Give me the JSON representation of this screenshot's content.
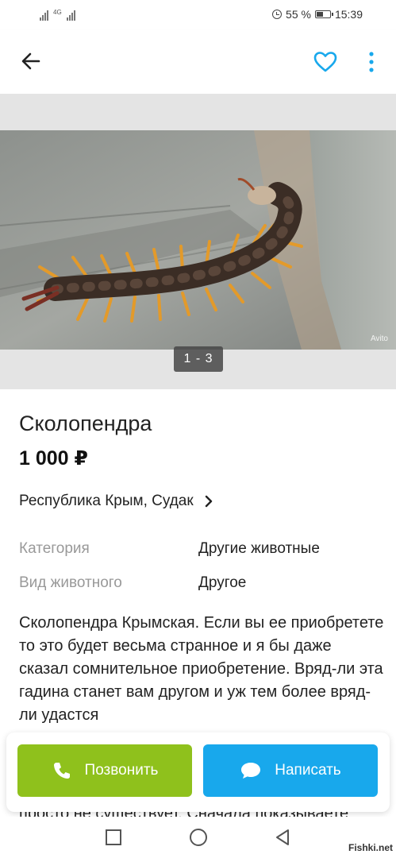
{
  "status_bar": {
    "network_label": "4G",
    "battery_percent": "55 %",
    "battery_level": 0.55,
    "time": "15:39"
  },
  "app_bar": {
    "back_icon": "arrow-left-icon",
    "favorite_icon": "heart-outline-icon",
    "more_icon": "more-vert-icon",
    "accent_color": "#18a8ec"
  },
  "gallery": {
    "counter": "1 - 3",
    "watermark": "Avito"
  },
  "listing": {
    "title": "Сколопендра",
    "price": "1 000 ₽",
    "location": "Республика Крым, Судак",
    "params": [
      {
        "label": "Категория",
        "value": "Другие животные"
      },
      {
        "label": "Вид животного",
        "value": "Другое"
      }
    ],
    "description": "Сколопендра Крымская. Если  вы ее приобретете то это будет весьма странное и я бы даже сказал сомнительное приобретение. Вряд-ли эта гадина станет вам другом и уж тем более вряд-ли удастся",
    "description_tail": "просто не существует. Сначала показываете"
  },
  "actions": {
    "call_label": "Позвонить",
    "call_color": "#8fc11c",
    "write_label": "Написать",
    "write_color": "#18a8ec"
  },
  "nav": {
    "recents_icon": "square-icon",
    "home_icon": "circle-icon",
    "back_icon": "triangle-back-icon"
  },
  "site_watermark": "Fishki.net"
}
